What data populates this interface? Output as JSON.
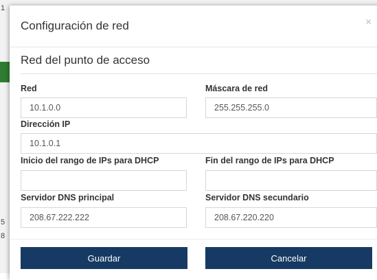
{
  "background": {
    "glyphs": [
      "1",
      "5",
      "8"
    ]
  },
  "modal": {
    "title": "Configuración de red",
    "close_symbol": "×"
  },
  "section": {
    "title": "Red del punto de acceso"
  },
  "fields": {
    "red": {
      "label": "Red",
      "value": "10.1.0.0"
    },
    "mascara": {
      "label": "Máscara de red",
      "value": "255.255.255.0"
    },
    "ip": {
      "label": "Dirección IP",
      "value": "10.1.0.1"
    },
    "dhcp_inicio": {
      "label": "Inicio del rango de IPs para DHCP",
      "value": ""
    },
    "dhcp_fin": {
      "label": "Fin del rango de IPs para DHCP",
      "value": ""
    },
    "dns1": {
      "label": "Servidor DNS principal",
      "value": "208.67.222.222"
    },
    "dns2": {
      "label": "Servidor DNS secundario",
      "value": "208.67.220.220"
    }
  },
  "buttons": {
    "save": "Guardar",
    "cancel": "Cancelar"
  },
  "colors": {
    "button_bg": "#163a63",
    "bg_accent": "#2e7d32"
  }
}
